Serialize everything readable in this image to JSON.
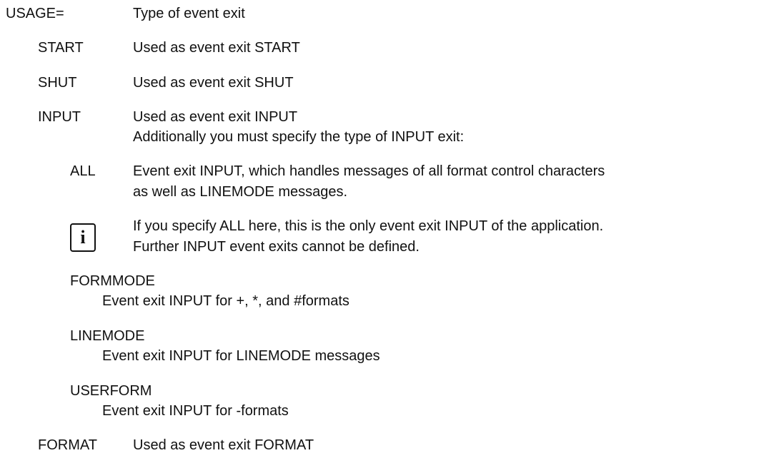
{
  "usage": {
    "term": "USAGE=",
    "description": "Type of event exit"
  },
  "options": [
    {
      "term": "START",
      "description": "Used as event exit START"
    },
    {
      "term": "SHUT",
      "description": "Used as event exit SHUT"
    },
    {
      "term": "INPUT",
      "description": "Used as event exit INPUT",
      "note": "Additionally you must specify the type of INPUT exit:"
    },
    {
      "term": "FORMAT",
      "description": "Used as event exit FORMAT"
    }
  ],
  "input_types": {
    "all": {
      "term": "ALL",
      "line1": "Event exit INPUT, which handles messages of all format control characters",
      "line2": "as well as LINEMODE messages."
    },
    "info": {
      "icon": "info-icon",
      "icon_glyph": "i",
      "line1": "If you specify ALL here, this is the only event exit INPUT of the application.",
      "line2": "Further INPUT event exits cannot be defined."
    },
    "formmode": {
      "term": "FORMMODE",
      "description": "Event exit INPUT for +, *, and #formats"
    },
    "linemode": {
      "term": "LINEMODE",
      "description": "Event exit INPUT for LINEMODE messages"
    },
    "userform": {
      "term": "USERFORM",
      "description": "Event exit INPUT for -formats"
    }
  }
}
